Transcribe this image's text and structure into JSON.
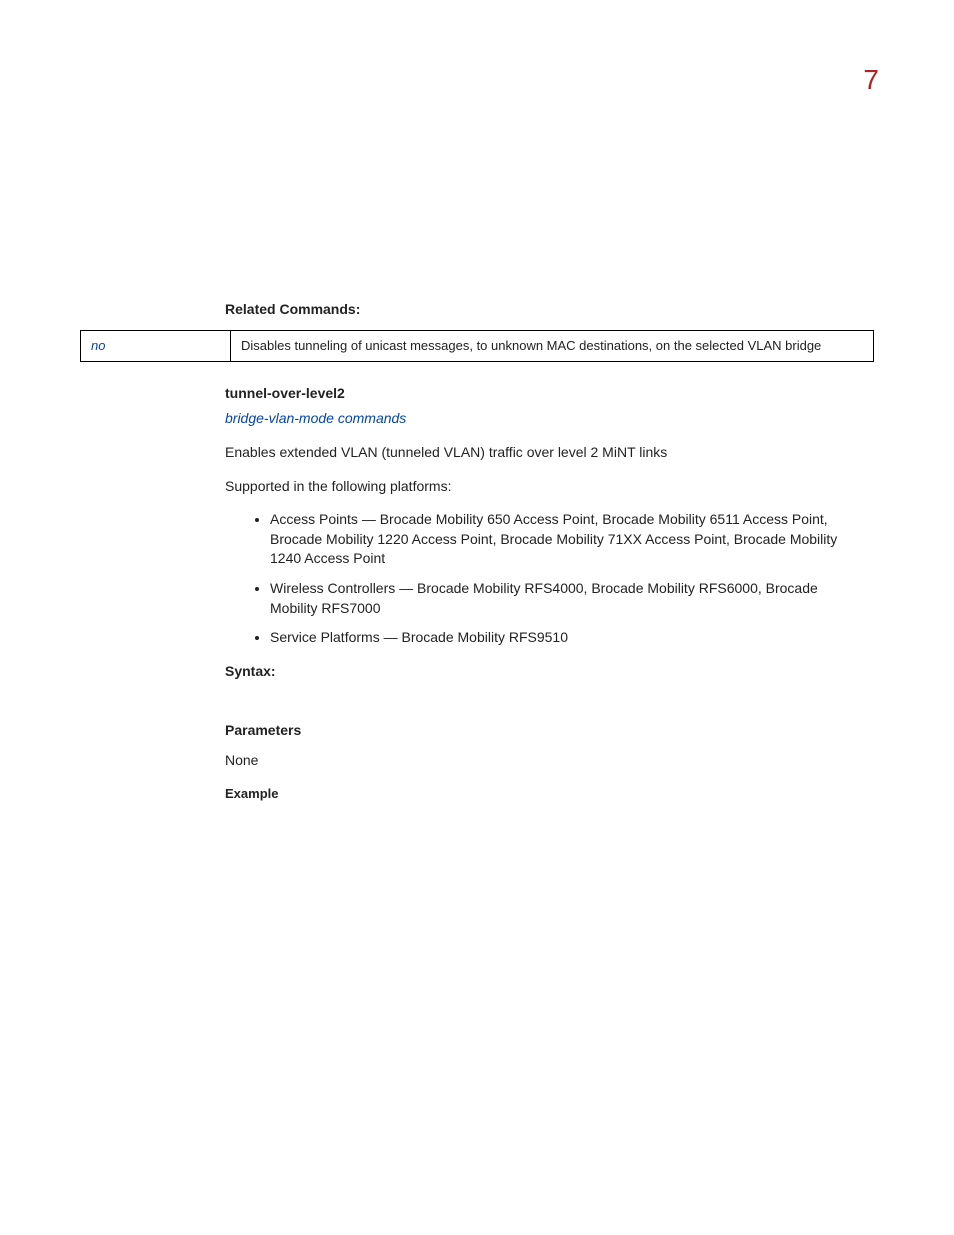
{
  "page_number": "7",
  "related_commands_heading": "Related Commands:",
  "related_commands": [
    {
      "name": "no",
      "desc": "Disables tunneling of unicast messages, to unknown MAC destinations, on the selected VLAN bridge"
    }
  ],
  "command_name": "tunnel-over-level2",
  "parent_link": "bridge-vlan-mode commands",
  "description": "Enables extended VLAN (tunneled VLAN) traffic over level 2 MiNT links",
  "supported_text": "Supported in the following platforms:",
  "platforms": [
    "Access Points — Brocade Mobility 650 Access Point, Brocade Mobility 6511 Access Point, Brocade Mobility 1220 Access Point, Brocade Mobility 71XX Access Point, Brocade Mobility 1240 Access Point",
    "Wireless Controllers — Brocade Mobility RFS4000, Brocade Mobility RFS6000, Brocade Mobility RFS7000",
    "Service Platforms — Brocade Mobility RFS9510"
  ],
  "syntax_heading": "Syntax:",
  "parameters_heading": "Parameters",
  "parameters_value": "None",
  "example_heading": "Example"
}
